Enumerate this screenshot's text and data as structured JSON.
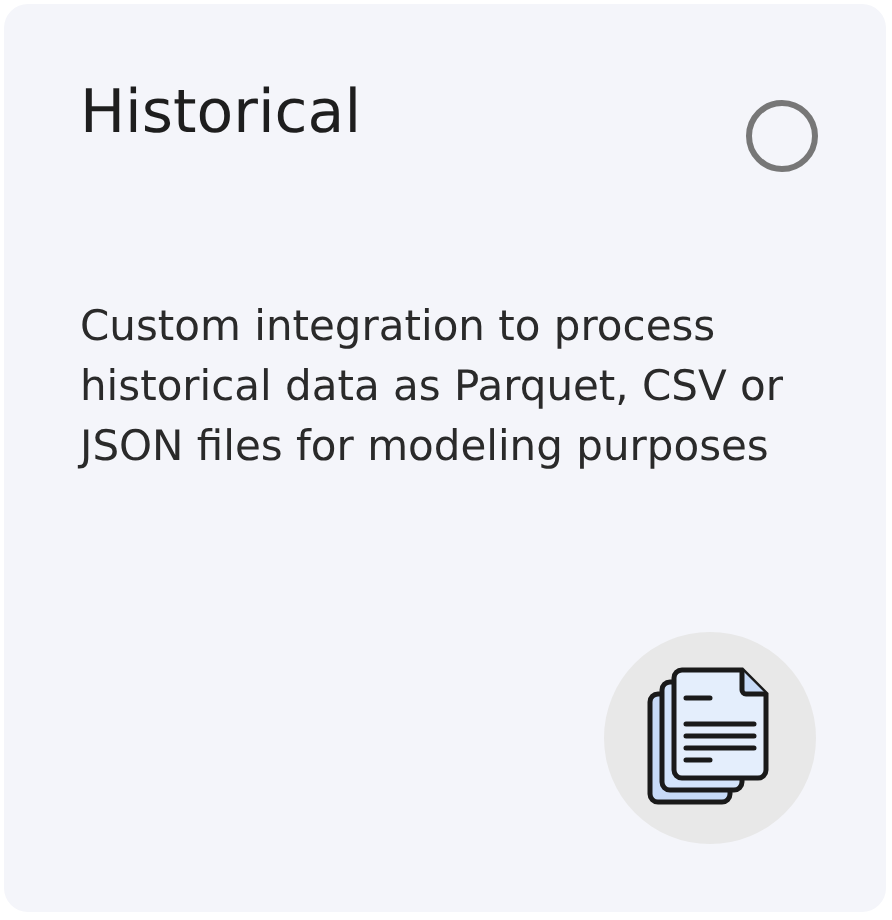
{
  "card": {
    "title": "Historical",
    "selected": false,
    "description": "Custom integration to process historical data as Parquet, CSV or JSON files for modeling purposes"
  }
}
